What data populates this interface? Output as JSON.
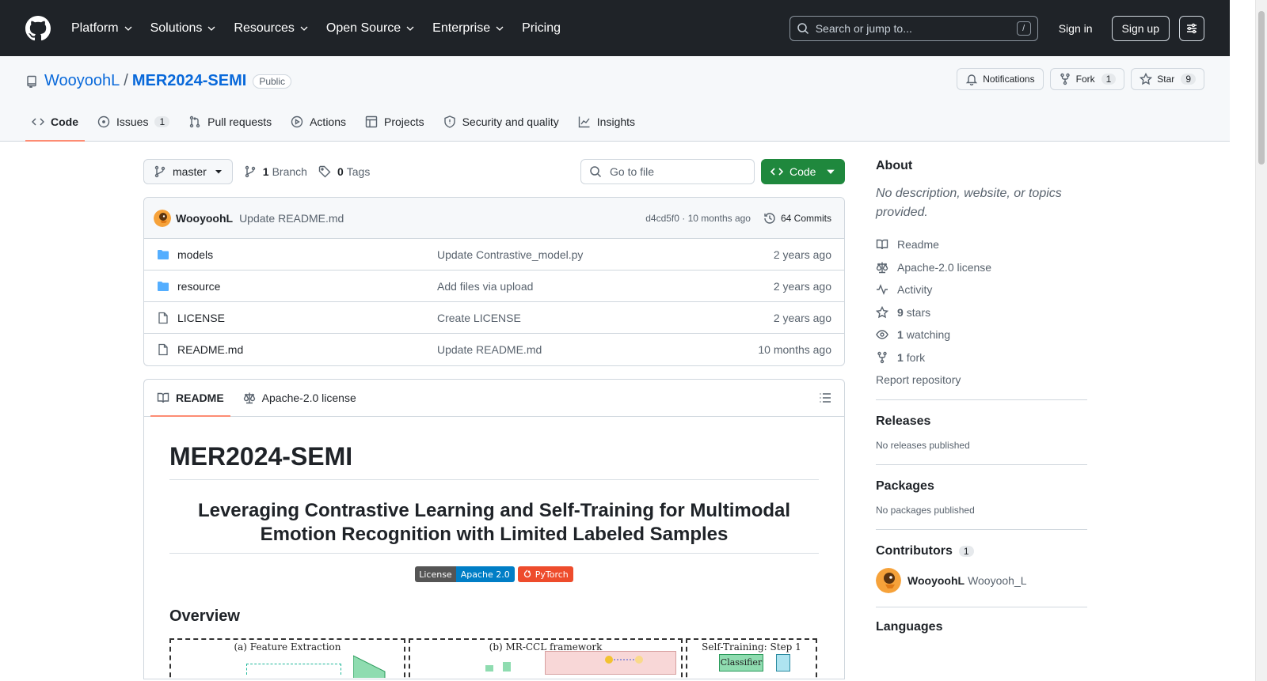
{
  "header": {
    "nav": [
      "Platform",
      "Solutions",
      "Resources",
      "Open Source",
      "Enterprise",
      "Pricing"
    ],
    "search_placeholder": "Search or jump to...",
    "search_shortcut": "/",
    "signin": "Sign in",
    "signup": "Sign up"
  },
  "repo": {
    "owner": "WooyoohL",
    "separator": "/",
    "name": "MER2024-SEMI",
    "visibility": "Public",
    "actions": {
      "notifications": "Notifications",
      "fork_label": "Fork",
      "fork_count": "1",
      "star_label": "Star",
      "star_count": "9"
    },
    "tabs": [
      {
        "label": "Code",
        "icon": "code-icon"
      },
      {
        "label": "Issues",
        "count": "1",
        "icon": "issue-icon"
      },
      {
        "label": "Pull requests",
        "icon": "pull-request-icon"
      },
      {
        "label": "Actions",
        "icon": "play-icon"
      },
      {
        "label": "Projects",
        "icon": "table-icon"
      },
      {
        "label": "Security and quality",
        "icon": "shield-icon"
      },
      {
        "label": "Insights",
        "icon": "graph-icon"
      }
    ]
  },
  "toolbar": {
    "branch": "master",
    "branch_count": "1",
    "branch_label": "Branch",
    "tag_count": "0",
    "tag_label": "Tags",
    "goto_placeholder": "Go to file",
    "code_button": "Code"
  },
  "commit": {
    "author": "WooyoohL",
    "message": "Update README.md",
    "hash_time": "d4cd5f0 · 10 months ago",
    "commits": "64 Commits"
  },
  "files": [
    {
      "type": "folder",
      "name": "models",
      "message": "Update Contrastive_model.py",
      "date": "2 years ago"
    },
    {
      "type": "folder",
      "name": "resource",
      "message": "Add files via upload",
      "date": "2 years ago"
    },
    {
      "type": "file",
      "name": "LICENSE",
      "message": "Create LICENSE",
      "date": "2 years ago"
    },
    {
      "type": "file",
      "name": "README.md",
      "message": "Update README.md",
      "date": "10 months ago"
    }
  ],
  "readme": {
    "tab_readme": "README",
    "tab_license": "Apache-2.0 license",
    "title": "MER2024-SEMI",
    "subtitle": "Leveraging Contrastive Learning and Self-Training for Multimodal Emotion Recognition with Limited Labeled Samples",
    "badge_license_left": "License",
    "badge_license_right": "Apache 2.0",
    "badge_pytorch": "PyTorch",
    "overview": "Overview",
    "figure_panels": [
      "(a) Feature Extraction",
      "(b) MR-CCL framework",
      "Self-Training: Step 1"
    ],
    "figure_labels": [
      "Classifier"
    ]
  },
  "sidebar": {
    "about_title": "About",
    "about_desc": "No description, website, or topics provided.",
    "links": [
      {
        "icon": "book-icon",
        "text": "Readme"
      },
      {
        "icon": "law-icon",
        "text": "Apache-2.0 license"
      },
      {
        "icon": "pulse-icon",
        "text": "Activity"
      },
      {
        "icon": "star-icon",
        "num": "9",
        "text": "stars"
      },
      {
        "icon": "eye-icon",
        "num": "1",
        "text": "watching"
      },
      {
        "icon": "fork-icon",
        "num": "1",
        "text": "fork"
      }
    ],
    "report": "Report repository",
    "releases_title": "Releases",
    "releases_text": "No releases published",
    "packages_title": "Packages",
    "packages_text": "No packages published",
    "contributors_title": "Contributors",
    "contributors_count": "1",
    "contributor_login": "WooyoohL",
    "contributor_name": "Wooyooh_L",
    "languages_title": "Languages"
  },
  "colors": {
    "header_bg": "#1f2328",
    "link": "#0969da",
    "primary_button": "#1f883d",
    "active_tab_underline": "#fd8c73",
    "folder": "#54aeff"
  }
}
